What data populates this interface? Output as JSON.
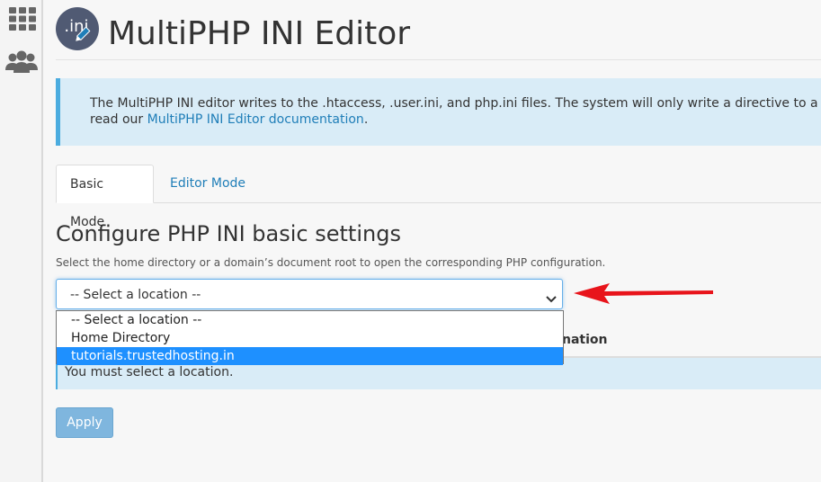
{
  "sidebar": {
    "icons": [
      "grid-icon",
      "users-icon"
    ]
  },
  "header": {
    "logo_text": ".ini",
    "title": "MultiPHP INI Editor"
  },
  "info_alert": {
    "text_line1": "The MultiPHP INI editor writes to the .htaccess, .user.ini, and php.ini files. The system will only write a directive to a file if",
    "text_line2_prefix": "read our ",
    "link_text": "MultiPHP INI Editor documentation",
    "text_line2_suffix": "."
  },
  "tabs": [
    {
      "label": "Basic Mode",
      "active": true
    },
    {
      "label": "Editor Mode",
      "active": false
    }
  ],
  "section": {
    "title": "Configure PHP INI basic settings",
    "description": "Select the home directory or a domain’s document root to open the corresponding PHP configuration."
  },
  "location_select": {
    "value": "-- Select a location --",
    "options": [
      "-- Select a location --",
      "Home Directory",
      "tutorials.trustedhosting.in"
    ],
    "highlighted_option": "tutorials.trustedhosting.in"
  },
  "table": {
    "header_fragment": "nation"
  },
  "warning": {
    "text": "You must select a location."
  },
  "apply_button": {
    "label": "Apply"
  },
  "colors": {
    "accent": "#1f7eb8",
    "info_bg": "#d9ecf7",
    "info_border": "#4bacdf",
    "highlight": "#1e90ff",
    "annotation_arrow": "#e8141b",
    "button_disabled": "#7fb6de"
  }
}
